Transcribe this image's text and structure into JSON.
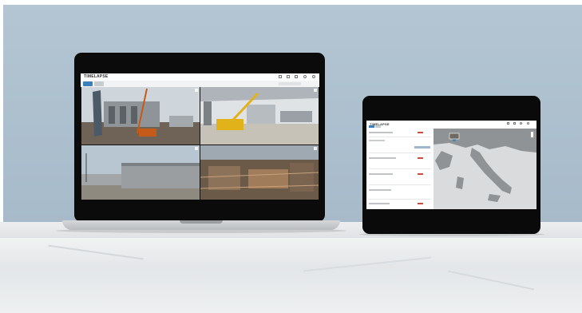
{
  "laptop": {
    "logo": "TIMELAPSE",
    "cameras": [
      {
        "caption": ""
      },
      {
        "caption": ""
      },
      {
        "caption": ""
      },
      {
        "caption": ""
      }
    ]
  },
  "tablet": {
    "logo": "TIMELAPSE"
  }
}
